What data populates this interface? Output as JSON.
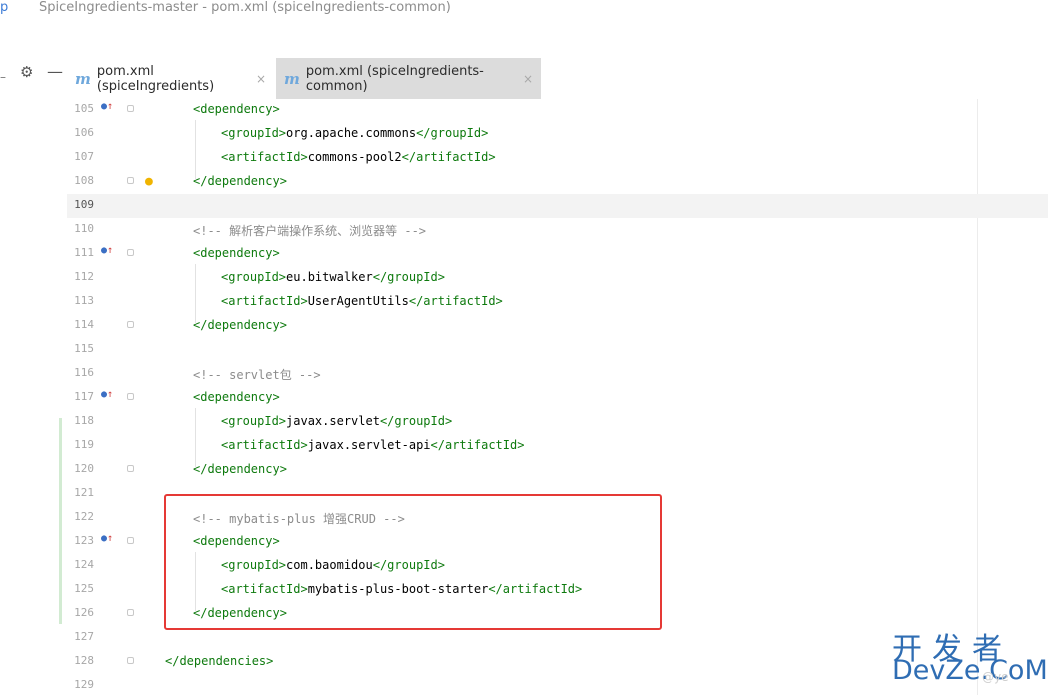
{
  "window": {
    "title_prefix": "p",
    "title": "SpiceIngredients-master - pom.xml (spiceIngredients-common)"
  },
  "toolbar": {
    "separator_glyph": "–",
    "settings_icon": "gear-icon",
    "hide_icon": "minus-icon"
  },
  "tabs": [
    {
      "icon": "m",
      "label": "pom.xml (spiceIngredients)",
      "close": "×",
      "active": false
    },
    {
      "icon": "m",
      "label": "pom.xml (spiceIngredients-common)",
      "close": "×",
      "active": true
    }
  ],
  "editor": {
    "current_line": 109,
    "lines": [
      {
        "n": "105",
        "indent": 1,
        "gutter": "impl",
        "fold": true,
        "parts": [
          [
            "tag",
            "<dependency>"
          ]
        ]
      },
      {
        "n": "106",
        "indent": 2,
        "parts": [
          [
            "tag",
            "<groupId>"
          ],
          [
            "text",
            "org.apache.commons"
          ],
          [
            "tag",
            "</groupId>"
          ]
        ]
      },
      {
        "n": "107",
        "indent": 2,
        "parts": [
          [
            "tag",
            "<artifactId>"
          ],
          [
            "text",
            "commons-pool2"
          ],
          [
            "tag",
            "</artifactId>"
          ]
        ]
      },
      {
        "n": "108",
        "indent": 1,
        "fold": true,
        "bulb": true,
        "parts": [
          [
            "tag",
            "</dependency>"
          ]
        ]
      },
      {
        "n": "109",
        "indent": 0,
        "parts": []
      },
      {
        "n": "110",
        "indent": 1,
        "parts": [
          [
            "cmt",
            "<!-- 解析客户端操作系统、浏览器等 -->"
          ]
        ]
      },
      {
        "n": "111",
        "indent": 1,
        "gutter": "impl",
        "fold": true,
        "parts": [
          [
            "tag",
            "<dependency>"
          ]
        ]
      },
      {
        "n": "112",
        "indent": 2,
        "parts": [
          [
            "tag",
            "<groupId>"
          ],
          [
            "text",
            "eu.bitwalker"
          ],
          [
            "tag",
            "</groupId>"
          ]
        ]
      },
      {
        "n": "113",
        "indent": 2,
        "parts": [
          [
            "tag",
            "<artifactId>"
          ],
          [
            "text",
            "UserAgentUtils"
          ],
          [
            "tag",
            "</artifactId>"
          ]
        ]
      },
      {
        "n": "114",
        "indent": 1,
        "fold": true,
        "parts": [
          [
            "tag",
            "</dependency>"
          ]
        ]
      },
      {
        "n": "115",
        "indent": 0,
        "parts": []
      },
      {
        "n": "116",
        "indent": 1,
        "parts": [
          [
            "cmt",
            "<!-- servlet包 -->"
          ]
        ]
      },
      {
        "n": "117",
        "indent": 1,
        "gutter": "impl",
        "fold": true,
        "parts": [
          [
            "tag",
            "<dependency>"
          ]
        ]
      },
      {
        "n": "118",
        "indent": 2,
        "parts": [
          [
            "tag",
            "<groupId>"
          ],
          [
            "text",
            "javax.servlet"
          ],
          [
            "tag",
            "</groupId>"
          ]
        ]
      },
      {
        "n": "119",
        "indent": 2,
        "parts": [
          [
            "tag",
            "<artifactId>"
          ],
          [
            "text",
            "javax.servlet-api"
          ],
          [
            "tag",
            "</artifactId>"
          ]
        ]
      },
      {
        "n": "120",
        "indent": 1,
        "fold": true,
        "parts": [
          [
            "tag",
            "</dependency>"
          ]
        ]
      },
      {
        "n": "121",
        "indent": 0,
        "parts": []
      },
      {
        "n": "122",
        "indent": 1,
        "parts": [
          [
            "cmt",
            "<!-- mybatis-plus 增强CRUD -->"
          ]
        ]
      },
      {
        "n": "123",
        "indent": 1,
        "gutter": "impl",
        "fold": true,
        "parts": [
          [
            "tag",
            "<dependency>"
          ]
        ]
      },
      {
        "n": "124",
        "indent": 2,
        "parts": [
          [
            "tag",
            "<groupId>"
          ],
          [
            "text",
            "com.baomidou"
          ],
          [
            "tag",
            "</groupId>"
          ]
        ]
      },
      {
        "n": "125",
        "indent": 2,
        "parts": [
          [
            "tag",
            "<artifactId>"
          ],
          [
            "text",
            "mybatis-plus-boot-starter"
          ],
          [
            "tag",
            "</artifactId>"
          ]
        ]
      },
      {
        "n": "126",
        "indent": 1,
        "fold": true,
        "parts": [
          [
            "tag",
            "</dependency>"
          ]
        ]
      },
      {
        "n": "127",
        "indent": 0,
        "parts": []
      },
      {
        "n": "128",
        "indent": 0,
        "fold": true,
        "parts": [
          [
            "tag",
            "</dependencies>"
          ]
        ]
      },
      {
        "n": "129",
        "indent": 0,
        "parts": []
      }
    ]
  },
  "watermark": {
    "cn": "开发者",
    "en": "DevZe.CoM",
    "faint": "@ye"
  }
}
